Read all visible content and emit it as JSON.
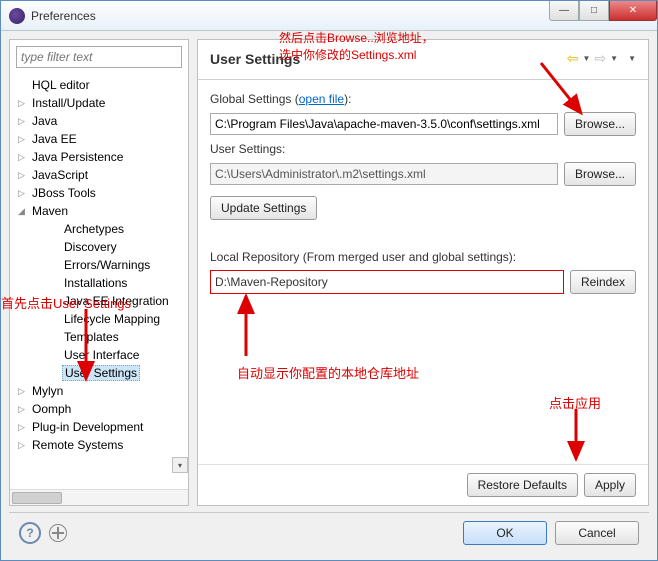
{
  "window": {
    "title": "Preferences"
  },
  "filter": {
    "placeholder": "type filter text"
  },
  "tree": {
    "items": [
      {
        "label": "HQL editor",
        "level": 1,
        "expand": ""
      },
      {
        "label": "Install/Update",
        "level": 1,
        "expand": "▷"
      },
      {
        "label": "Java",
        "level": 1,
        "expand": "▷"
      },
      {
        "label": "Java EE",
        "level": 1,
        "expand": "▷"
      },
      {
        "label": "Java Persistence",
        "level": 1,
        "expand": "▷"
      },
      {
        "label": "JavaScript",
        "level": 1,
        "expand": "▷"
      },
      {
        "label": "JBoss Tools",
        "level": 1,
        "expand": "▷"
      },
      {
        "label": "Maven",
        "level": 1,
        "expand": "◢"
      },
      {
        "label": "Archetypes",
        "level": 2,
        "expand": ""
      },
      {
        "label": "Discovery",
        "level": 2,
        "expand": ""
      },
      {
        "label": "Errors/Warnings",
        "level": 2,
        "expand": ""
      },
      {
        "label": "Installations",
        "level": 2,
        "expand": ""
      },
      {
        "label": "Java EE Integration",
        "level": 2,
        "expand": ""
      },
      {
        "label": "Lifecycle Mapping",
        "level": 2,
        "expand": ""
      },
      {
        "label": "Templates",
        "level": 2,
        "expand": ""
      },
      {
        "label": "User Interface",
        "level": 2,
        "expand": ""
      },
      {
        "label": "User Settings",
        "level": 2,
        "expand": "",
        "selected": true
      },
      {
        "label": "Mylyn",
        "level": 1,
        "expand": "▷"
      },
      {
        "label": "Oomph",
        "level": 1,
        "expand": "▷"
      },
      {
        "label": "Plug-in Development",
        "level": 1,
        "expand": "▷"
      },
      {
        "label": "Remote Systems",
        "level": 1,
        "expand": "▷"
      }
    ]
  },
  "page": {
    "title": "User Settings",
    "global_label_prefix": "Global Settings (",
    "global_label_link": "open file",
    "global_label_suffix": "):",
    "global_value": "C:\\Program Files\\Java\\apache-maven-3.5.0\\conf\\settings.xml",
    "browse1": "Browse...",
    "user_label": "User Settings:",
    "user_value": "C:\\Users\\Administrator\\.m2\\settings.xml",
    "browse2": "Browse...",
    "update": "Update Settings",
    "local_repo_label": "Local Repository (From merged user and global settings):",
    "local_repo_value": "D:\\Maven-Repository",
    "reindex": "Reindex",
    "restore": "Restore Defaults",
    "apply": "Apply"
  },
  "footer": {
    "ok": "OK",
    "cancel": "Cancel"
  },
  "annotations": {
    "a1_line1": "然后点击Browse..浏览地址，",
    "a1_line2": "选中你修改的Settings.xml",
    "a2": "首先点击User Settings",
    "a3": "自动显示你配置的本地仓库地址",
    "a4": "点击应用"
  }
}
